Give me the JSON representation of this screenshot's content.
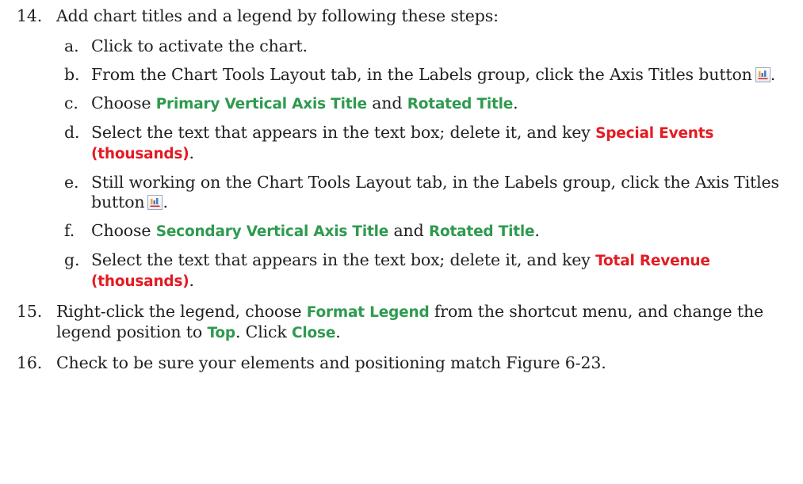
{
  "steps": {
    "s14": {
      "number": "14.",
      "text": "Add chart titles and a legend by following these steps:",
      "substeps": {
        "a": {
          "letter": "a.",
          "text": "Click to activate the chart."
        },
        "b": {
          "letter": "b.",
          "text_1": "From the Chart Tools Layout tab, in the Labels group, click the Axis Titles button",
          "text_2": "."
        },
        "c": {
          "letter": "c.",
          "text_1": "Choose ",
          "kw_1": "Primary Vertical Axis Title",
          "text_2": " and ",
          "kw_2": "Rotated Title",
          "text_3": "."
        },
        "d": {
          "letter": "d.",
          "text_1": "Select the text that appears in the text box; delete it, and key ",
          "kw_1": "Special Events (thousands)",
          "text_2": "."
        },
        "e": {
          "letter": "e.",
          "text_1": "Still working on the Chart Tools Layout tab, in the Labels group, click the Axis Titles button",
          "text_2": "."
        },
        "f": {
          "letter": "f.",
          "text_1": "Choose ",
          "kw_1": "Secondary Vertical Axis Title",
          "text_2": " and ",
          "kw_2": "Rotated Title",
          "text_3": "."
        },
        "g": {
          "letter": "g.",
          "text_1": "Select the text that appears in the text box; delete it, and key ",
          "kw_1": "Total Revenue (thousands)",
          "text_2": "."
        }
      }
    },
    "s15": {
      "number": "15.",
      "text_1": "Right-click the legend, choose ",
      "kw_1": "Format Legend",
      "text_2": " from the shortcut menu, and change the legend position to ",
      "kw_2": "Top",
      "text_3": ". Click ",
      "kw_3": "Close",
      "text_4": "."
    },
    "s16": {
      "number": "16.",
      "text": "Check to be sure your elements and positioning match Figure 6-23."
    }
  },
  "icons": {
    "axis_titles_button": "axis-titles-icon"
  },
  "colors": {
    "text": "#231f20",
    "keyword_green": "#2f9a4f",
    "keyword_red": "#e31b23"
  }
}
